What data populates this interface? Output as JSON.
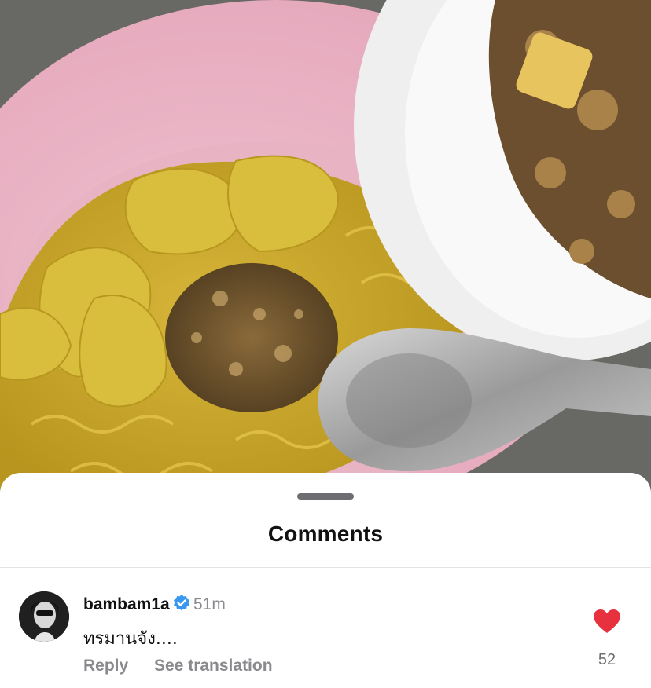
{
  "photo": {
    "description_icon": "food-photo"
  },
  "sheet": {
    "title": "Comments"
  },
  "comment": {
    "username": "bambam1a",
    "time": "51m",
    "text": "ทรมานจัง....",
    "reply_label": "Reply",
    "translate_label": "See translation",
    "like_count": "52",
    "verified_icon": "verified-badge-icon",
    "like_icon": "heart-icon"
  },
  "colors": {
    "like_red": "#e8313f",
    "verified_blue": "#3897f0"
  }
}
